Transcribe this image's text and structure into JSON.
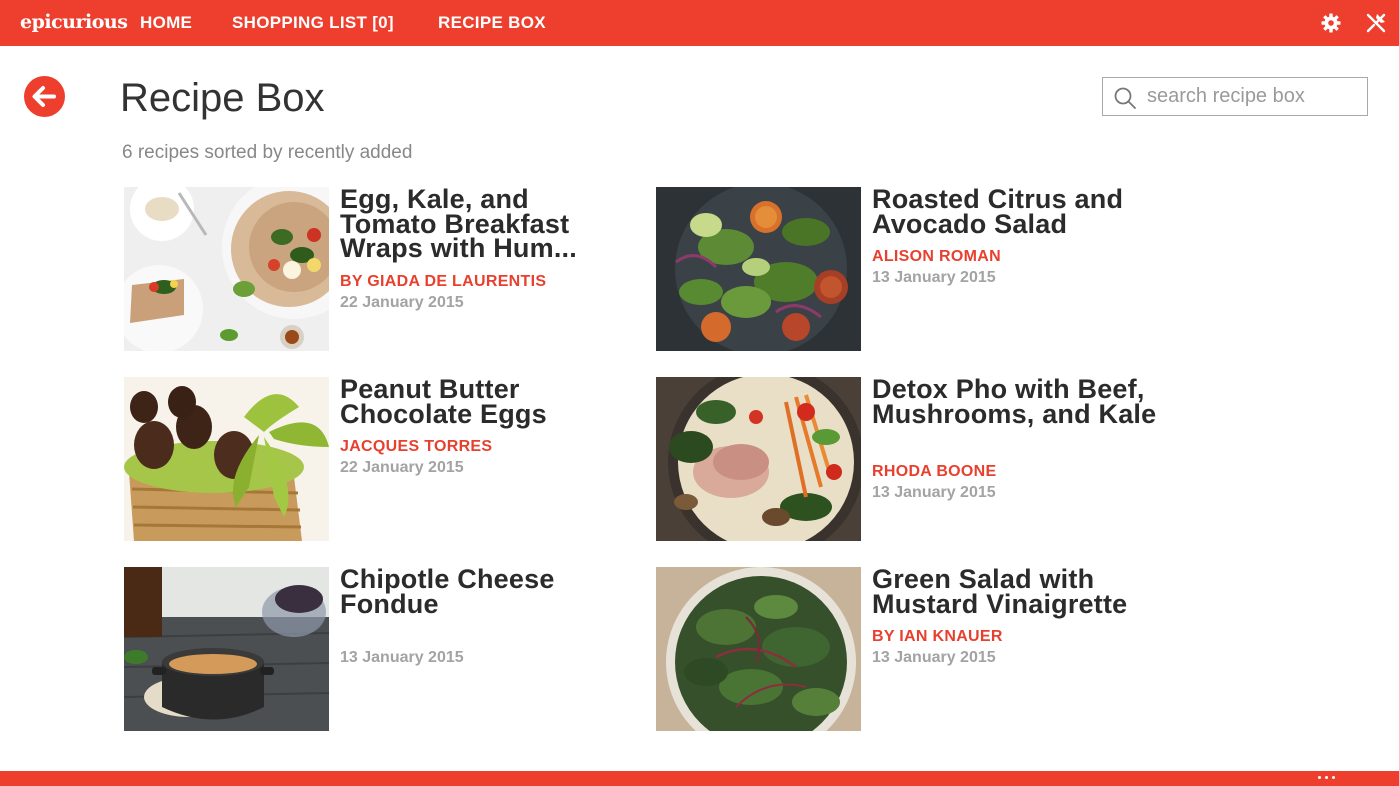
{
  "app": {
    "logo": "epicurious",
    "nav": {
      "home": "HOME",
      "shopping_list": "SHOPPING LIST [0]",
      "recipe_box": "RECIPE BOX"
    },
    "accent_color": "#ee3f2e"
  },
  "header": {
    "title": "Recipe Box",
    "subtitle": "6 recipes sorted by recently added",
    "search_placeholder": "search recipe box"
  },
  "recipes": [
    {
      "title": "Egg, Kale, and Tomato Breakfast Wraps with Hum...",
      "author": "BY GIADA DE LAURENTIS",
      "date": "22 January 2015",
      "image": "breakfast-wraps-photo"
    },
    {
      "title": "Roasted Citrus and Avocado Salad",
      "author": "ALISON ROMAN",
      "date": "13 January 2015",
      "image": "citrus-salad-photo"
    },
    {
      "title": "Peanut Butter Chocolate Eggs",
      "author": "JACQUES TORRES",
      "date": "22 January 2015",
      "image": "chocolate-eggs-basket-photo"
    },
    {
      "title": "Detox Pho with Beef, Mushrooms, and Kale",
      "author": "RHODA BOONE",
      "date": "13 January 2015",
      "image": "pho-bowl-photo"
    },
    {
      "title": "Chipotle Cheese Fondue",
      "author": "",
      "date": "13 January 2015",
      "image": "fondue-pot-photo"
    },
    {
      "title": "Green Salad with Mustard Vinaigrette",
      "author": "BY IAN KNAUER",
      "date": "13 January 2015",
      "image": "green-salad-photo"
    }
  ],
  "icons": {
    "settings": "gear-icon",
    "pin": "unpin-icon",
    "back": "back-arrow-icon",
    "search": "search-icon",
    "more": "more-ellipsis-icon"
  }
}
